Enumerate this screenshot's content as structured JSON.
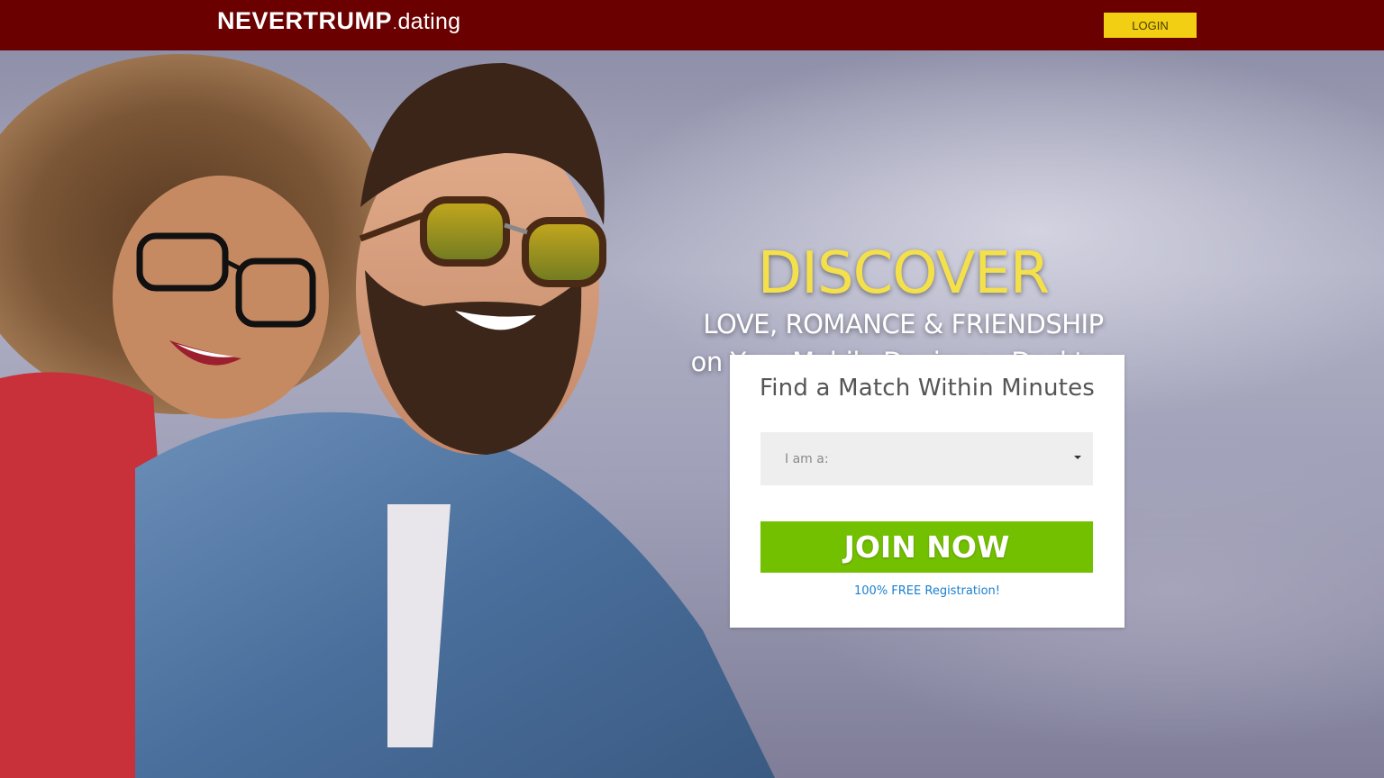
{
  "header": {
    "logo": {
      "strong": "NEVERTRUMP",
      "dot": ".",
      "light": "dating"
    },
    "login_label": "LOGIN",
    "background_color": "#6b0000",
    "login_color": "#f2cf13"
  },
  "hero": {
    "headline": "DISCOVER",
    "subline1": "LOVE, ROMANCE & FRIENDSHIP",
    "subline2": "on Your Mobile Device or Desktop",
    "headline_color": "#f4e04a",
    "image": "smiling couple photo"
  },
  "signup": {
    "title": "Find a Match Within Minutes",
    "select": {
      "value": "I am a:",
      "icon": "chevron-down-icon"
    },
    "join_label": "JOIN NOW",
    "join_color": "#73c000",
    "free_label": "100% FREE Registration!",
    "link_color": "#1a7fcf"
  }
}
